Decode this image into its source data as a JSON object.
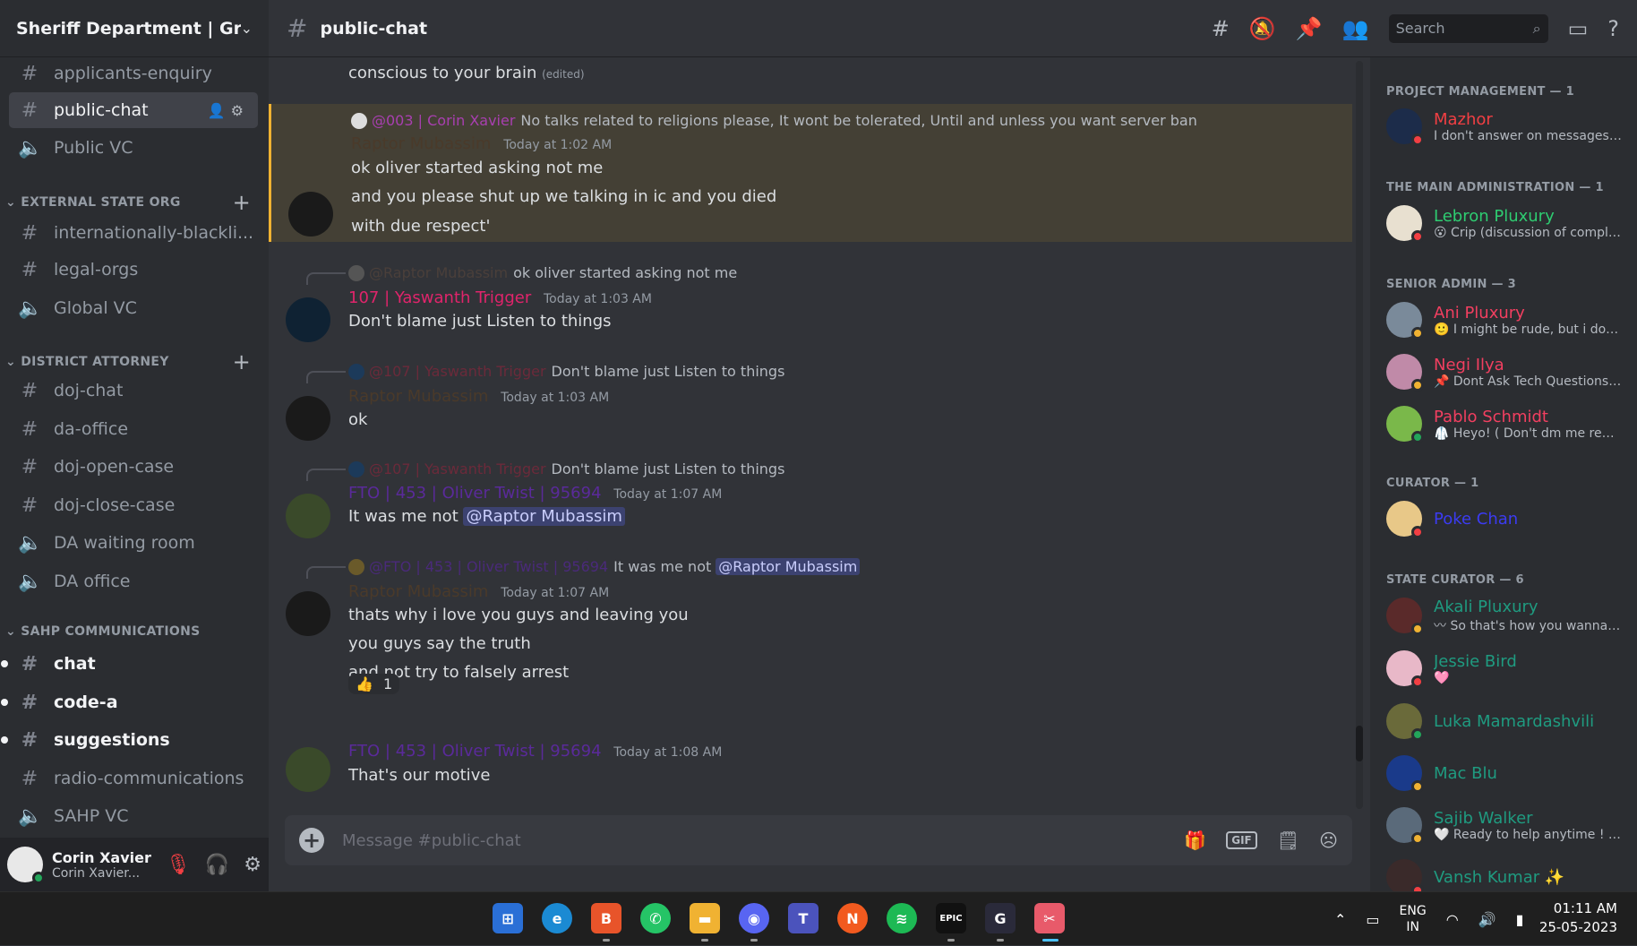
{
  "server": {
    "name": "Sheriff Department | Gra..."
  },
  "channels_top": [
    {
      "name": "applicants-enquiry",
      "type": "text"
    },
    {
      "name": "public-chat",
      "type": "text",
      "active": true
    },
    {
      "name": "Public VC",
      "type": "voice"
    }
  ],
  "categories": [
    {
      "name": "EXTERNAL STATE ORG",
      "channels": [
        {
          "name": "internationally-blackli...",
          "type": "text"
        },
        {
          "name": "legal-orgs",
          "type": "text"
        },
        {
          "name": "Global VC",
          "type": "voice"
        }
      ]
    },
    {
      "name": "DISTRICT ATTORNEY",
      "channels": [
        {
          "name": "doj-chat",
          "type": "text"
        },
        {
          "name": "da-office",
          "type": "text"
        },
        {
          "name": "doj-open-case",
          "type": "text"
        },
        {
          "name": "doj-close-case",
          "type": "text"
        },
        {
          "name": "DA waiting room",
          "type": "voice"
        },
        {
          "name": "DA office",
          "type": "voice"
        }
      ]
    },
    {
      "name": "SAHP COMMUNICATIONS",
      "channels": [
        {
          "name": "chat",
          "type": "text",
          "unread": true
        },
        {
          "name": "code-a",
          "type": "text",
          "unread": true
        },
        {
          "name": "suggestions",
          "type": "text",
          "unread": true
        },
        {
          "name": "radio-communications",
          "type": "text"
        },
        {
          "name": "SAHP VC",
          "type": "voice"
        }
      ]
    }
  ],
  "user": {
    "name": "Corin Xavier",
    "sub": "Corin Xavier..."
  },
  "topbar": {
    "channel": "public-chat",
    "search_placeholder": "Search"
  },
  "messages": {
    "m0": {
      "text": "conscious to your brain",
      "edited": "(edited)"
    },
    "m1": {
      "reply_author": "@003 | Corin Xavier",
      "reply_text": "No talks related to religions please, It wont be tolerated, Until and unless you want server ban",
      "author": "Raptor Mubassim",
      "time": "Today at 1:02 AM",
      "lines": [
        "ok oliver started asking not me",
        "and you please shut up we talking in ic and you died",
        "with due respect'"
      ]
    },
    "m2": {
      "reply_author": "@Raptor Mubassim",
      "reply_text": "ok oliver started asking not me",
      "author": "107 | Yaswanth Trigger",
      "time": "Today at 1:03 AM",
      "lines": [
        "Don't blame just Listen to things"
      ]
    },
    "m3": {
      "reply_author": "@107 | Yaswanth Trigger",
      "reply_text": "Don't blame just Listen to things",
      "author": "Raptor Mubassim",
      "time": "Today at 1:03 AM",
      "lines": [
        "ok"
      ]
    },
    "m4": {
      "reply_author": "@107 | Yaswanth Trigger",
      "reply_text": "Don't blame just Listen to things",
      "author": "FTO | 453 | Oliver Twist | 95694",
      "time": "Today at 1:07 AM",
      "text": "It was me not",
      "mention": "@Raptor Mubassim"
    },
    "m5": {
      "reply_author": "@FTO | 453 | Oliver Twist | 95694",
      "reply_text": "It was me not",
      "reply_mention": "@Raptor Mubassim",
      "author": "Raptor Mubassim",
      "time": "Today at 1:07 AM",
      "lines": [
        "thats why i love you guys and leaving you",
        "you guys say the truth",
        "and not try to falsely arrest"
      ],
      "reaction_emoji": "👍",
      "reaction_count": "1"
    },
    "m6": {
      "author": "FTO | 453 | Oliver Twist | 95694",
      "time": "Today at 1:08 AM",
      "lines": [
        "That's our motive"
      ]
    }
  },
  "composer": {
    "placeholder": "Message #public-chat",
    "gif": "GIF"
  },
  "members": {
    "groups": [
      {
        "title": "PROJECT MANAGEMENT — 1"
      },
      {
        "title": "THE MAIN ADMINISTRATION — 1"
      },
      {
        "title": "SENIOR ADMIN — 3"
      },
      {
        "title": "CURATOR — 1"
      },
      {
        "title": "STATE CURATOR — 6"
      }
    ],
    "list": [
      {
        "name": "Mazhor",
        "status": "I don't answer on messages \"H...",
        "color": "#f23f43"
      },
      {
        "name": "Lebron Pluxury",
        "status": "😮 Crip (discussion of compla...",
        "color": "#2ecc71"
      },
      {
        "name": "Ani Pluxury",
        "status": "🙂 I might be rude, but i do w...",
        "color": "#f23f60"
      },
      {
        "name": "Negi Ilya",
        "status": "📌 Dont Ask Tech Questions i...",
        "color": "#f23f60"
      },
      {
        "name": "Pablo Schmidt",
        "status": "🥼 Heyo! ( Don't dm me regar...",
        "color": "#f23f60"
      },
      {
        "name": "Poke Chan",
        "status": "",
        "color": "#3b3bf2"
      },
      {
        "name": "Akali Pluxury",
        "status": "〰 So that's how you wanna P...",
        "color": "#1f9b80"
      },
      {
        "name": "Jessie Bird",
        "status": "🩷",
        "color": "#1f9b80"
      },
      {
        "name": "Luka Mamardashvili",
        "status": "",
        "color": "#1f9b80"
      },
      {
        "name": "Mac Blu",
        "status": "",
        "color": "#1f9b80"
      },
      {
        "name": "Sajib Walker",
        "status": "🤍 Ready to help anytime ! ( ...",
        "color": "#1f9b80"
      },
      {
        "name": "Vansh Kumar ✨",
        "status": "",
        "color": "#1f9b80"
      }
    ]
  },
  "taskbar": {
    "lang1": "ENG",
    "lang2": "IN",
    "time": "01:11 AM",
    "date": "25-05-2023"
  },
  "colors": {
    "accent": "#5865f2",
    "online": "#23a55a",
    "dnd": "#f23f43",
    "idle": "#f0b232",
    "highlight": "#444035"
  }
}
